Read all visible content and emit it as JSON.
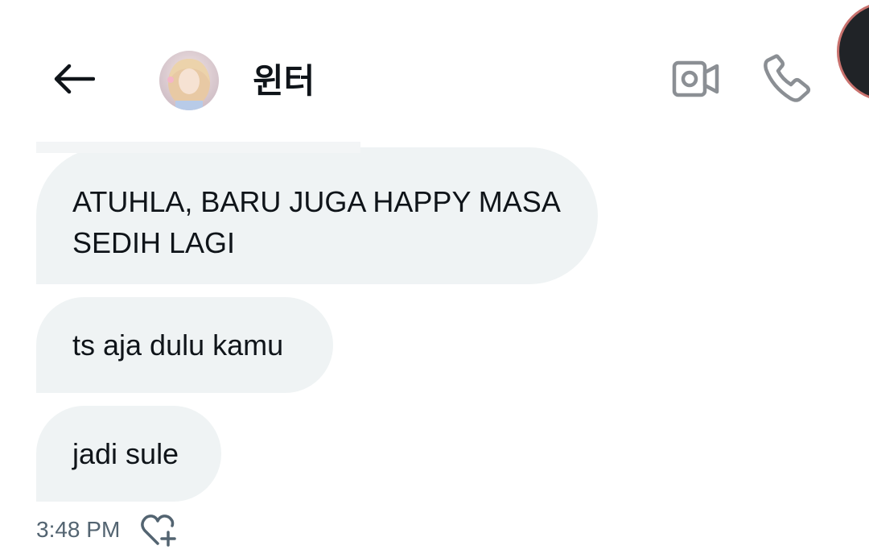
{
  "header": {
    "contact_name": "윈터",
    "back_icon": "arrow-left-icon",
    "video_icon": "video-camera-icon",
    "call_icon": "phone-icon"
  },
  "messages": [
    {
      "lines": [
        "ATUHLA, BARU JUGA HAPPY MASA",
        "SEDIH LAGI"
      ]
    },
    {
      "text": "ts aja dulu kamu"
    },
    {
      "text": "jadi sule"
    }
  ],
  "meta": {
    "timestamp": "3:48 PM",
    "react_icon": "heart-plus-icon"
  },
  "colors": {
    "bubble_bg": "#eff3f4",
    "text": "#0f1419",
    "muted": "#536471",
    "icon_gray": "#8b8f94"
  }
}
